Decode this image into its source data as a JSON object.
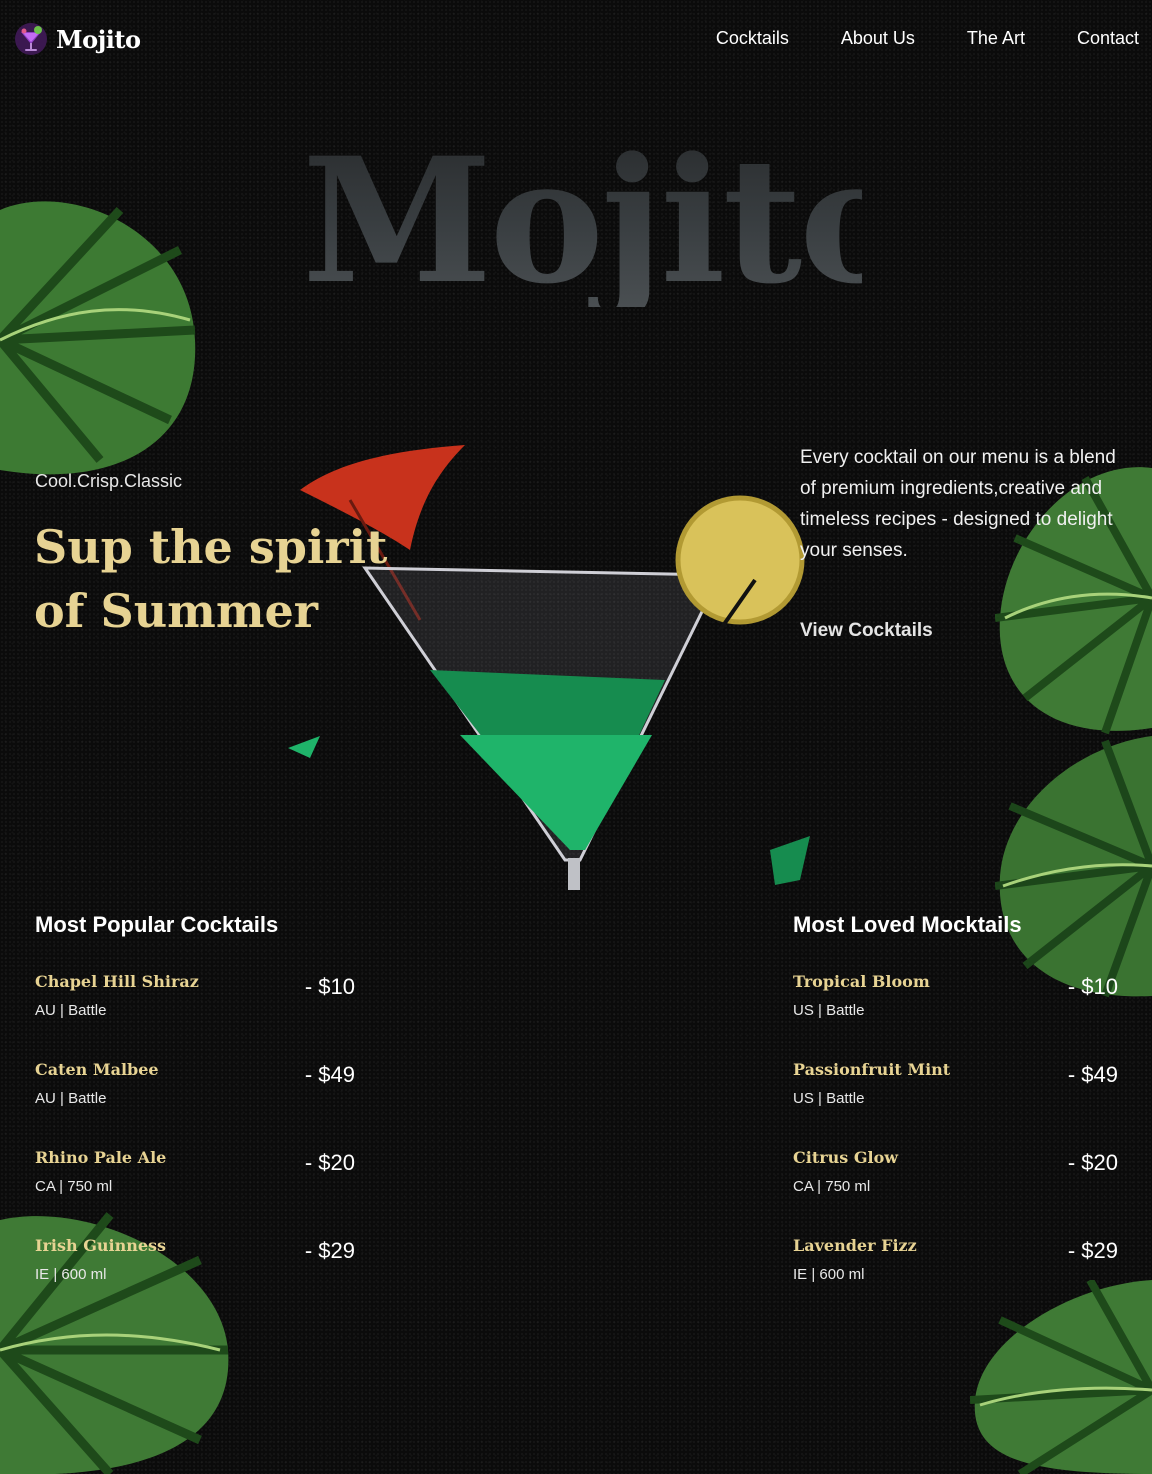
{
  "brand": {
    "name": "Mojito",
    "icon": "cocktail-glass-icon"
  },
  "nav": {
    "links": [
      "Cocktails",
      "About Us",
      "The Art",
      "Contact"
    ]
  },
  "hero": {
    "title": "Mojito",
    "tagline": "Cool.Crisp.Classic",
    "headline_line1": "Sup the spirit",
    "headline_line2": "of Summer",
    "description": "Every cocktail on our menu is a blend of premium ingredients,creative and timeless recipes - designed to delight your senses.",
    "cta": "View Cocktails"
  },
  "cocktails": {
    "heading": "Most Popular Cocktails",
    "items": [
      {
        "name": "Chapel Hill Shiraz",
        "meta": "AU | Battle",
        "price": "- $10"
      },
      {
        "name": "Caten Malbee",
        "meta": "AU | Battle",
        "price": "- $49"
      },
      {
        "name": "Rhino Pale Ale",
        "meta": "CA | 750 ml",
        "price": "- $20"
      },
      {
        "name": "Irish Guinness",
        "meta": "IE | 600 ml",
        "price": "- $29"
      }
    ]
  },
  "mocktails": {
    "heading": "Most Loved Mocktails",
    "items": [
      {
        "name": "Tropical Bloom",
        "meta": "US | Battle",
        "price": "- $10"
      },
      {
        "name": "Passionfruit Mint",
        "meta": "US | Battle",
        "price": "- $49"
      },
      {
        "name": "Citrus Glow",
        "meta": "CA | 750 ml",
        "price": "- $20"
      },
      {
        "name": "Lavender Fizz",
        "meta": "IE | 600 ml",
        "price": "- $29"
      }
    ]
  },
  "colors": {
    "accent": "#e7d393",
    "background": "#0b0b0b",
    "leaf": "#3f7a35",
    "drink": "#1fb46a",
    "umbrella": "#c8321c",
    "lemon": "#d9c25a"
  }
}
